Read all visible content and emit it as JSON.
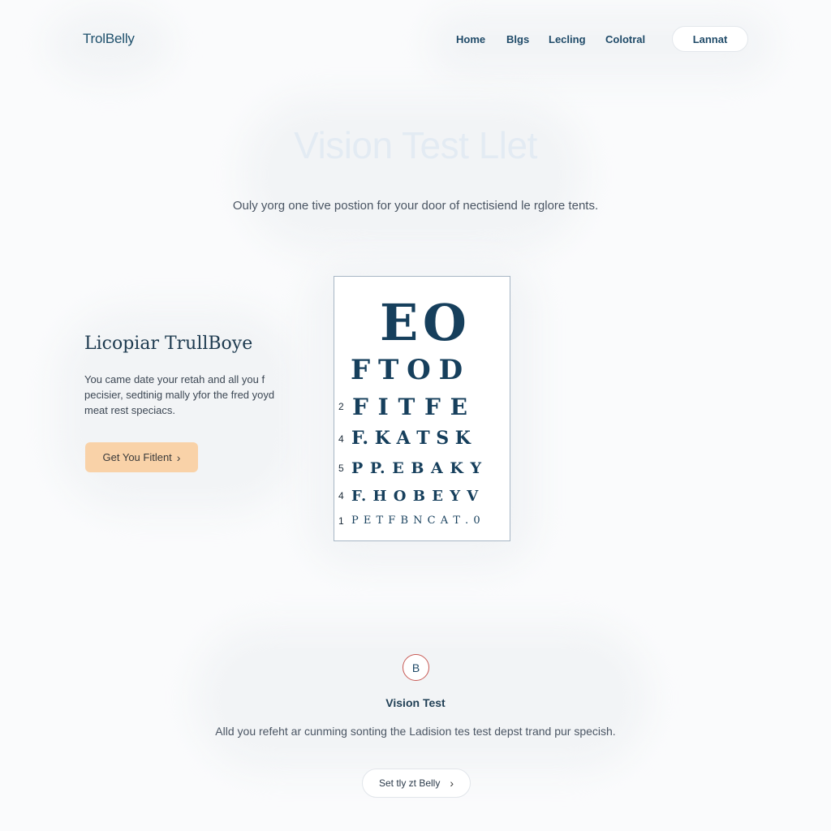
{
  "header": {
    "logo": "TrolBelly",
    "nav": [
      "Home",
      "Blgs",
      "Lecling",
      "Colotral"
    ],
    "action_button": "Lannat"
  },
  "hero": {
    "title": "Vision Test Llet",
    "subtitle": "Ouly yorg one tive postion for your door of nectisiend le rglore tents."
  },
  "feature": {
    "title": "Licopiar TrullBoye",
    "description": "You came date your retah and all you f pecisier, sedtinig mally yfor the fred yoyd meat rest speciacs.",
    "cta_label": "Get You Fitlent",
    "cta_icon": "chevron-right-icon"
  },
  "eye_chart": {
    "rows": [
      {
        "num": "",
        "letters": "E O"
      },
      {
        "num": "",
        "letters": "F T O D"
      },
      {
        "num": "2",
        "letters": "F I T F E"
      },
      {
        "num": "4",
        "letters": "F. K A T S K"
      },
      {
        "num": "5",
        "letters": "P P. E B A K Y"
      },
      {
        "num": "4",
        "letters": "F. H O B E Y V"
      },
      {
        "num": "1",
        "letters": "P E T F B N C A T .  0"
      }
    ]
  },
  "bottom": {
    "badge": "B",
    "title": "Vision Test",
    "description": "Alld you refeht ar cunming sonting the Ladision tes test depst trand pur specish.",
    "button_label": "Set tly zt Belly",
    "button_icon": "chevron-right-icon"
  },
  "colors": {
    "brand": "#1d4f6b",
    "cta": "#f9d2a8",
    "chart_text": "#163f5c",
    "badge_ring": "#c85a55"
  }
}
